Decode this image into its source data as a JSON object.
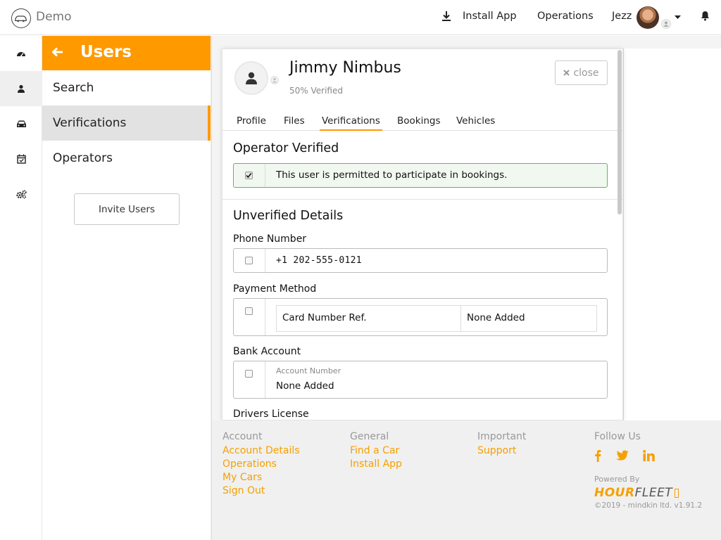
{
  "topbar": {
    "brand": "Demo",
    "install_app": "Install App",
    "operations": "Operations",
    "username": "Jezz"
  },
  "rail": {
    "icons": [
      "dashboard-icon",
      "user-icon",
      "car-icon",
      "calendar-check-icon",
      "cogs-icon"
    ],
    "active_index": 1
  },
  "users_panel": {
    "title": "Users",
    "items": [
      {
        "label": "Search"
      },
      {
        "label": "Verifications",
        "active": true
      },
      {
        "label": "Operators"
      }
    ],
    "invite_button": "Invite Users"
  },
  "modal": {
    "user_name": "Jimmy Nimbus",
    "verified_pct": "50% Verified",
    "close_label": "close",
    "tabs": [
      "Profile",
      "Files",
      "Verifications",
      "Bookings",
      "Vehicles"
    ],
    "active_tab": "Verifications",
    "operator_verified": {
      "title": "Operator Verified",
      "checked": true,
      "text": "This user is permitted to participate in bookings."
    },
    "unverified": {
      "title": "Unverified Details",
      "phone": {
        "label": "Phone Number",
        "value": "+1 202-555-0121",
        "checked": false
      },
      "payment": {
        "label": "Payment Method",
        "col1": "Card Number Ref.",
        "col2": "None Added",
        "checked": false
      },
      "bank": {
        "label": "Bank Account",
        "sub_label": "Account Number",
        "value": "None Added",
        "checked": false
      },
      "license": {
        "label": "Drivers License"
      }
    }
  },
  "footer": {
    "account": {
      "heading": "Account",
      "links": [
        "Account Details",
        "Operations",
        "My Cars",
        "Sign Out"
      ]
    },
    "general": {
      "heading": "General",
      "links": [
        "Find a Car",
        "Install App"
      ]
    },
    "important": {
      "heading": "Important",
      "links": [
        "Support"
      ]
    },
    "follow": {
      "heading": "Follow Us",
      "icons": [
        "facebook-icon",
        "twitter-icon",
        "linkedin-icon"
      ]
    },
    "powered_by": "Powered By",
    "brand_hour": "HOUR",
    "brand_fleet": "FLEET",
    "copyright": "©2019 - mindkin ltd. v1.91.2"
  },
  "colors": {
    "accent": "#ff9900",
    "link": "#f5a000",
    "success_border": "#5cb85c",
    "success_bg": "#f1f8f0"
  }
}
